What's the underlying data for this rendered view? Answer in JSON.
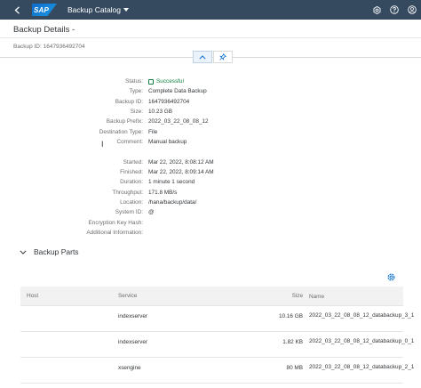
{
  "shell": {
    "logo_text": "SAP",
    "app_title": "Backup Catalog",
    "icons": [
      "back-icon",
      "dropdown-caret-icon",
      "settings-icon",
      "help-icon",
      "user-icon"
    ]
  },
  "header": {
    "title": "Backup Details -",
    "backup_id_line": "Backup ID: 1647936492704",
    "collapse_button_icon": "chevron-up-icon",
    "pin_button_icon": "pin-icon"
  },
  "details": [
    {
      "label": "Status:",
      "value": "Successful",
      "kind": "status"
    },
    {
      "label": "Type:",
      "value": "Complete Data Backup"
    },
    {
      "label": "Backup ID:",
      "value": "1647936492704"
    },
    {
      "label": "Size:",
      "value": "10.23 GB"
    },
    {
      "label": "Backup Prefix:",
      "value": "2022_03_22_08_08_12"
    },
    {
      "label": "Destination Type:",
      "value": "File"
    },
    {
      "label": "Comment:",
      "value": "Manual backup"
    },
    {
      "label": "Started:",
      "value": "Mar 22, 2022, 8:08:12 AM"
    },
    {
      "label": "Finished:",
      "value": "Mar 22, 2022, 8:09:14 AM"
    },
    {
      "label": "Duration:",
      "value": "1 minute 1 second"
    },
    {
      "label": "Throughput:",
      "value": "171.8 MB/s"
    },
    {
      "label": "Location:",
      "value": "/hana/backup/data/"
    },
    {
      "label": "System ID:",
      "value": "@"
    },
    {
      "label": "Encryption Key Hash:",
      "value": ""
    },
    {
      "label": "Additional Information:",
      "value": ""
    }
  ],
  "backup_parts": {
    "title": "Backup Parts",
    "columns": {
      "host": "Host",
      "service": "Service",
      "size": "Size",
      "name": "Name"
    },
    "rows": [
      {
        "host": "",
        "service": "indexserver",
        "size": "10.16 GB",
        "name": "2022_03_22_08_08_12_databackup_3_1"
      },
      {
        "host": "",
        "service": "indexserver",
        "size": "1.82 KB",
        "name": "2022_03_22_08_08_12_databackup_0_1"
      },
      {
        "host": "",
        "service": "xsengine",
        "size": "80 MB",
        "name": "2022_03_22_08_08_12_databackup_2_1"
      }
    ]
  },
  "colors": {
    "shell_bar": "#354a5f",
    "status_success": "#107e3e",
    "text_primary": "#32363a",
    "text_label": "#6a6d70"
  }
}
